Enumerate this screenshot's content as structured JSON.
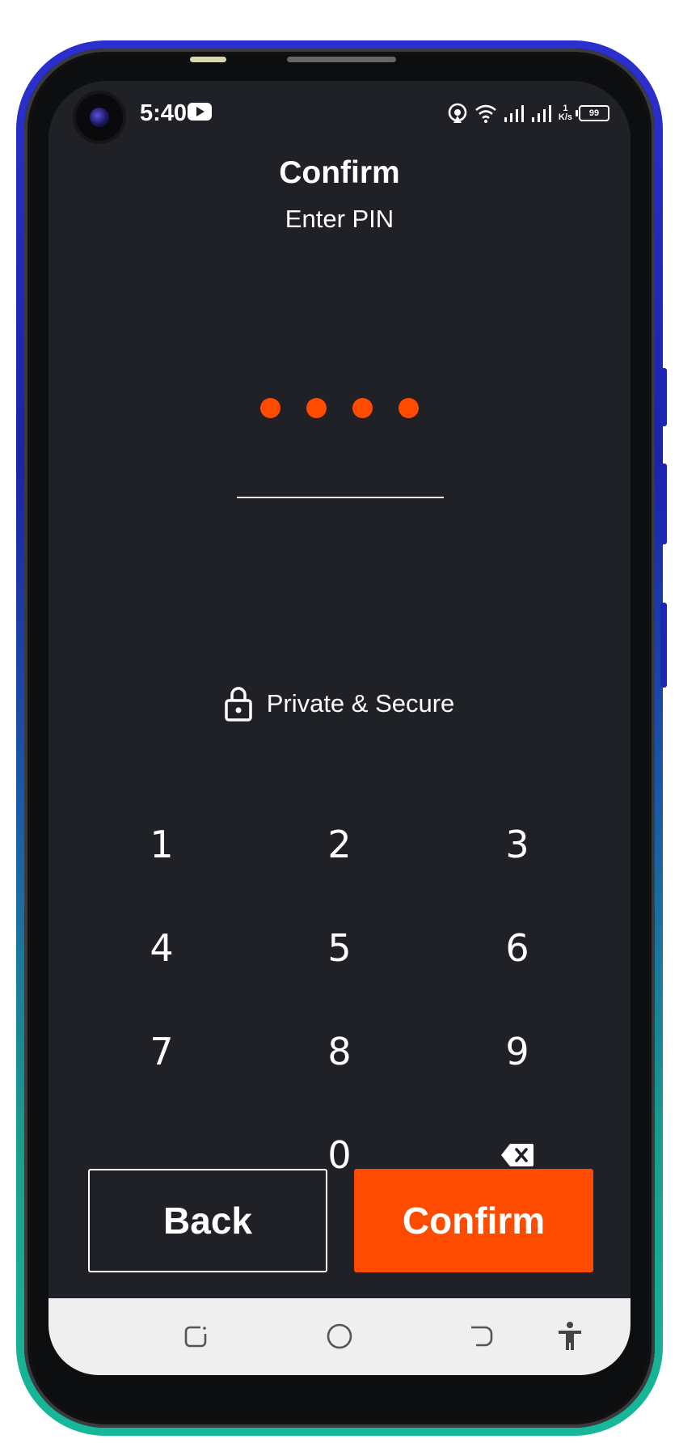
{
  "status_bar": {
    "time": "5:40",
    "network_speed_value": "1",
    "network_speed_unit": "K/s",
    "battery": "99",
    "icons": [
      "youtube-icon",
      "hotspot-icon",
      "wifi-icon",
      "signal-icon",
      "signal-icon",
      "battery-icon"
    ]
  },
  "header": {
    "title": "Confirm",
    "subtitle": "Enter PIN"
  },
  "pin": {
    "entered_digits": 4,
    "dot_color": "#ff4b00"
  },
  "secure": {
    "icon": "lock-icon",
    "label": "Private & Secure"
  },
  "keypad": {
    "keys": [
      "1",
      "2",
      "3",
      "4",
      "5",
      "6",
      "7",
      "8",
      "9",
      "",
      "0"
    ],
    "backspace_icon": "backspace-icon"
  },
  "actions": {
    "back_label": "Back",
    "confirm_label": "Confirm",
    "accent_color": "#ff4b00"
  },
  "nav_bar": {
    "icons": [
      "recents-icon",
      "home-icon",
      "back-icon",
      "accessibility-icon"
    ]
  }
}
